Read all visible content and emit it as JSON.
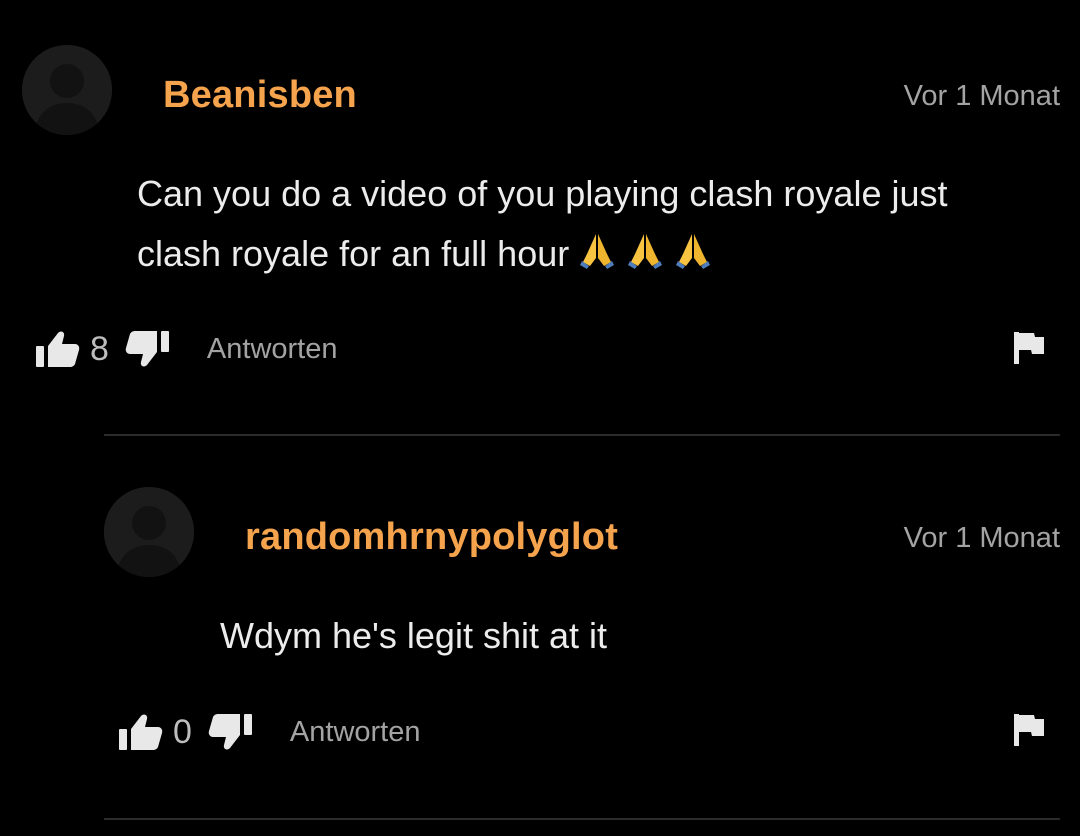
{
  "comments": [
    {
      "username": "Beanisben",
      "timestamp": "Vor 1 Monat",
      "text": "Can you do a video of you playing clash royale just clash royale for an full hour",
      "emoji": [
        "folded-hands",
        "folded-hands",
        "folded-hands"
      ],
      "likes": "8",
      "reply_label": "Antworten"
    },
    {
      "username": "randomhrnypolyglot",
      "timestamp": "Vor 1 Monat",
      "text": "Wdym he's legit shit at it",
      "likes": "0",
      "reply_label": "Antworten"
    }
  ],
  "colors": {
    "background": "#000000",
    "username": "#f5a34d",
    "text": "#ececec",
    "muted": "#a3a3a3",
    "divider": "#2b2b2b"
  }
}
